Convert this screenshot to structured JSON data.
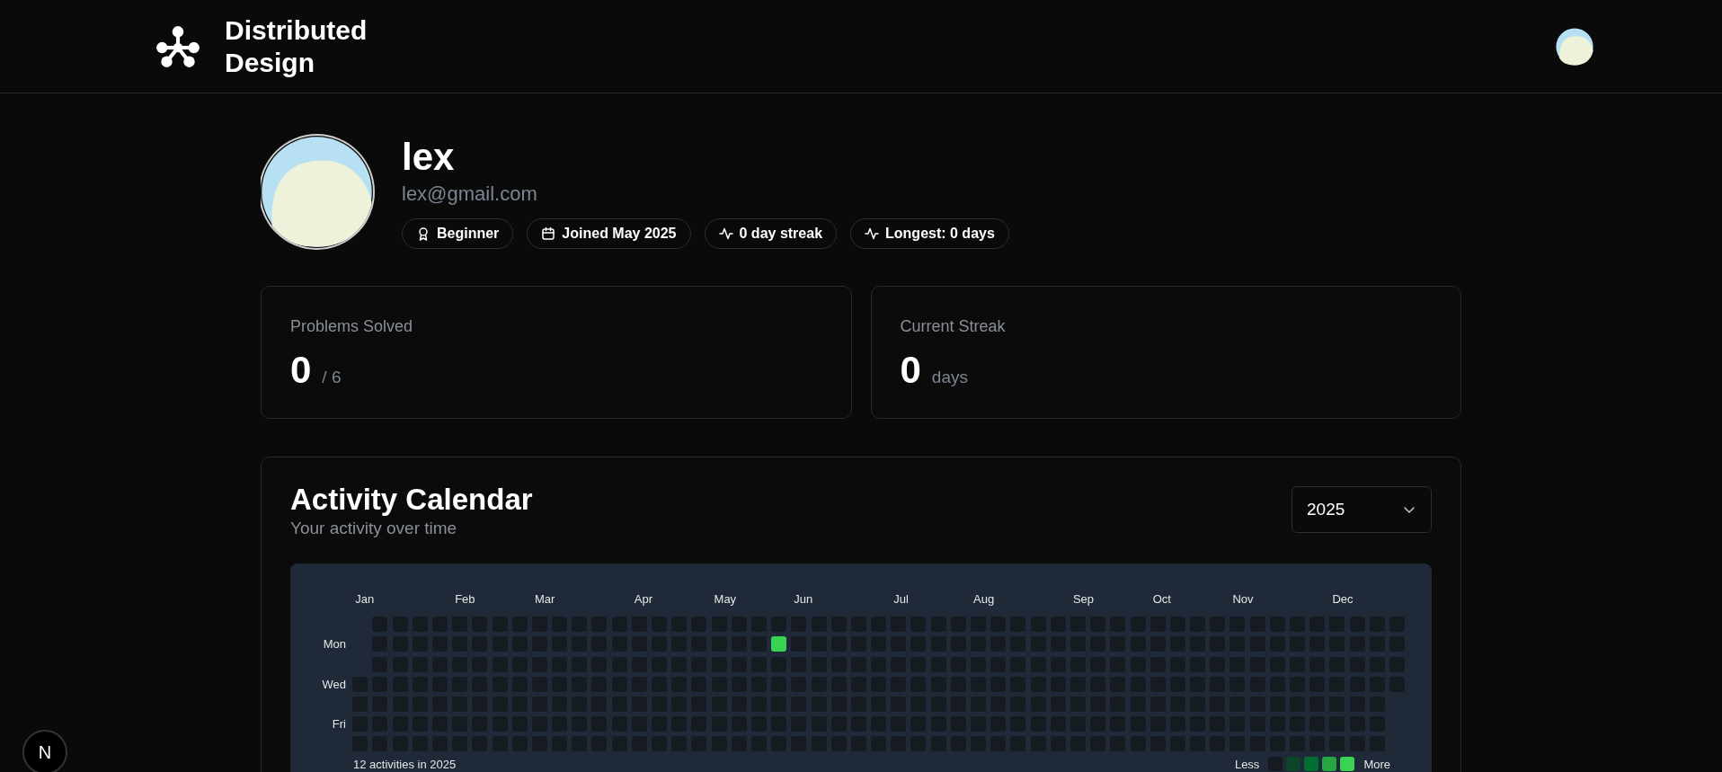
{
  "header": {
    "brand": "Distributed Design"
  },
  "profile": {
    "name": "lex",
    "email": "lex@gmail.com",
    "badges": [
      {
        "kind": "award",
        "label": "Beginner"
      },
      {
        "kind": "calendar",
        "label": "Joined May 2025"
      },
      {
        "kind": "activity",
        "label": "0 day streak"
      },
      {
        "kind": "activity",
        "label": "Longest: 0 days"
      }
    ]
  },
  "stats": [
    {
      "label": "Problems Solved",
      "value": "0",
      "suffix": "/ 6"
    },
    {
      "label": "Current Streak",
      "value": "0",
      "suffix": "days"
    }
  ],
  "activity_calendar": {
    "title": "Activity Calendar",
    "subtitle": "Your activity over time",
    "year_select": {
      "value": "2025"
    },
    "months": [
      "Jan",
      "Feb",
      "Mar",
      "Apr",
      "May",
      "Jun",
      "Jul",
      "Aug",
      "Sep",
      "Oct",
      "Nov",
      "Dec"
    ],
    "day_labels": [
      "Mon",
      "Wed",
      "Fri"
    ],
    "weeks": [
      {
        "days": [
          {
            "color": "#161b22"
          },
          {
            "color": "#161b22"
          },
          {
            "color": "#161b22"
          },
          {
            "color": "#161b22"
          }
        ]
      },
      {
        "days": [
          {
            "color": "#161b22"
          },
          {
            "color": "#161b22"
          },
          {
            "color": "#161b22"
          },
          {
            "color": "#161b22"
          },
          {
            "color": "#161b22"
          },
          {
            "color": "#161b22"
          },
          {
            "color": "#161b22"
          }
        ]
      },
      {
        "days": [
          {
            "color": "#161b22"
          },
          {
            "color": "#161b22"
          },
          {
            "color": "#161b22"
          },
          {
            "color": "#161b22"
          },
          {
            "color": "#161b22"
          },
          {
            "color": "#161b22"
          },
          {
            "color": "#161b22"
          }
        ]
      },
      {
        "days": [
          {
            "color": "#161b22"
          },
          {
            "color": "#161b22"
          },
          {
            "color": "#161b22"
          },
          {
            "color": "#161b22"
          },
          {
            "color": "#161b22"
          },
          {
            "color": "#161b22"
          },
          {
            "color": "#161b22"
          }
        ]
      },
      {
        "days": [
          {
            "color": "#161b22"
          },
          {
            "color": "#161b22"
          },
          {
            "color": "#161b22"
          },
          {
            "color": "#161b22"
          },
          {
            "color": "#161b22"
          },
          {
            "color": "#161b22"
          },
          {
            "color": "#161b22"
          }
        ]
      },
      {
        "days": [
          {
            "color": "#161b22"
          },
          {
            "color": "#161b22"
          },
          {
            "color": "#161b22"
          },
          {
            "color": "#161b22"
          },
          {
            "color": "#161b22"
          },
          {
            "color": "#161b22"
          },
          {
            "color": "#161b22"
          }
        ]
      },
      {
        "days": [
          {
            "color": "#161b22"
          },
          {
            "color": "#161b22"
          },
          {
            "color": "#161b22"
          },
          {
            "color": "#161b22"
          },
          {
            "color": "#161b22"
          },
          {
            "color": "#161b22"
          },
          {
            "color": "#161b22"
          }
        ]
      },
      {
        "days": [
          {
            "color": "#161b22"
          },
          {
            "color": "#161b22"
          },
          {
            "color": "#161b22"
          },
          {
            "color": "#161b22"
          },
          {
            "color": "#161b22"
          },
          {
            "color": "#161b22"
          },
          {
            "color": "#161b22"
          }
        ]
      },
      {
        "days": [
          {
            "color": "#161b22"
          },
          {
            "color": "#161b22"
          },
          {
            "color": "#161b22"
          },
          {
            "color": "#161b22"
          },
          {
            "color": "#161b22"
          },
          {
            "color": "#161b22"
          },
          {
            "color": "#161b22"
          }
        ]
      },
      {
        "days": [
          {
            "color": "#161b22"
          },
          {
            "color": "#161b22"
          },
          {
            "color": "#161b22"
          },
          {
            "color": "#161b22"
          },
          {
            "color": "#161b22"
          },
          {
            "color": "#161b22"
          },
          {
            "color": "#161b22"
          }
        ]
      },
      {
        "days": [
          {
            "color": "#161b22"
          },
          {
            "color": "#161b22"
          },
          {
            "color": "#161b22"
          },
          {
            "color": "#161b22"
          },
          {
            "color": "#161b22"
          },
          {
            "color": "#161b22"
          },
          {
            "color": "#161b22"
          }
        ]
      },
      {
        "days": [
          {
            "color": "#161b22"
          },
          {
            "color": "#161b22"
          },
          {
            "color": "#161b22"
          },
          {
            "color": "#161b22"
          },
          {
            "color": "#161b22"
          },
          {
            "color": "#161b22"
          },
          {
            "color": "#161b22"
          }
        ]
      },
      {
        "days": [
          {
            "color": "#161b22"
          },
          {
            "color": "#161b22"
          },
          {
            "color": "#161b22"
          },
          {
            "color": "#161b22"
          },
          {
            "color": "#161b22"
          },
          {
            "color": "#161b22"
          },
          {
            "color": "#161b22"
          }
        ]
      },
      {
        "days": [
          {
            "color": "#161b22"
          },
          {
            "color": "#161b22"
          },
          {
            "color": "#161b22"
          },
          {
            "color": "#161b22"
          },
          {
            "color": "#161b22"
          },
          {
            "color": "#161b22"
          },
          {
            "color": "#161b22"
          }
        ]
      },
      {
        "days": [
          {
            "color": "#161b22"
          },
          {
            "color": "#161b22"
          },
          {
            "color": "#161b22"
          },
          {
            "color": "#161b22"
          },
          {
            "color": "#161b22"
          },
          {
            "color": "#161b22"
          },
          {
            "color": "#161b22"
          }
        ]
      },
      {
        "days": [
          {
            "color": "#161b22"
          },
          {
            "color": "#161b22"
          },
          {
            "color": "#161b22"
          },
          {
            "color": "#161b22"
          },
          {
            "color": "#161b22"
          },
          {
            "color": "#161b22"
          },
          {
            "color": "#161b22"
          }
        ]
      },
      {
        "days": [
          {
            "color": "#161b22"
          },
          {
            "color": "#161b22"
          },
          {
            "color": "#161b22"
          },
          {
            "color": "#161b22"
          },
          {
            "color": "#161b22"
          },
          {
            "color": "#161b22"
          },
          {
            "color": "#161b22"
          }
        ]
      },
      {
        "days": [
          {
            "color": "#161b22"
          },
          {
            "color": "#161b22"
          },
          {
            "color": "#161b22"
          },
          {
            "color": "#161b22"
          },
          {
            "color": "#161b22"
          },
          {
            "color": "#161b22"
          },
          {
            "color": "#161b22"
          }
        ]
      },
      {
        "days": [
          {
            "color": "#161b22"
          },
          {
            "color": "#161b22"
          },
          {
            "color": "#161b22"
          },
          {
            "color": "#161b22"
          },
          {
            "color": "#161b22"
          },
          {
            "color": "#161b22"
          },
          {
            "color": "#161b22"
          }
        ]
      },
      {
        "days": [
          {
            "color": "#161b22"
          },
          {
            "color": "#161b22"
          },
          {
            "color": "#161b22"
          },
          {
            "color": "#161b22"
          },
          {
            "color": "#161b22"
          },
          {
            "color": "#161b22"
          },
          {
            "color": "#161b22"
          }
        ]
      },
      {
        "days": [
          {
            "color": "#161b22"
          },
          {
            "color": "#161b22"
          },
          {
            "color": "#161b22"
          },
          {
            "color": "#161b22"
          },
          {
            "color": "#161b22"
          },
          {
            "color": "#161b22"
          },
          {
            "color": "#161b22"
          }
        ]
      },
      {
        "days": [
          {
            "color": "#161b22"
          },
          {
            "color": "#39d353"
          },
          {
            "color": "#161b22"
          },
          {
            "color": "#161b22"
          },
          {
            "color": "#161b22"
          },
          {
            "color": "#161b22"
          },
          {
            "color": "#161b22"
          }
        ]
      },
      {
        "days": [
          {
            "color": "#161b22"
          },
          {
            "color": "#161b22"
          },
          {
            "color": "#161b22"
          },
          {
            "color": "#161b22"
          },
          {
            "color": "#161b22"
          },
          {
            "color": "#161b22"
          },
          {
            "color": "#161b22"
          }
        ]
      },
      {
        "days": [
          {
            "color": "#161b22"
          },
          {
            "color": "#161b22"
          },
          {
            "color": "#161b22"
          },
          {
            "color": "#161b22"
          },
          {
            "color": "#161b22"
          },
          {
            "color": "#161b22"
          },
          {
            "color": "#161b22"
          }
        ]
      },
      {
        "days": [
          {
            "color": "#161b22"
          },
          {
            "color": "#161b22"
          },
          {
            "color": "#161b22"
          },
          {
            "color": "#161b22"
          },
          {
            "color": "#161b22"
          },
          {
            "color": "#161b22"
          },
          {
            "color": "#161b22"
          }
        ]
      },
      {
        "days": [
          {
            "color": "#161b22"
          },
          {
            "color": "#161b22"
          },
          {
            "color": "#161b22"
          },
          {
            "color": "#161b22"
          },
          {
            "color": "#161b22"
          },
          {
            "color": "#161b22"
          },
          {
            "color": "#161b22"
          }
        ]
      },
      {
        "days": [
          {
            "color": "#161b22"
          },
          {
            "color": "#161b22"
          },
          {
            "color": "#161b22"
          },
          {
            "color": "#161b22"
          },
          {
            "color": "#161b22"
          },
          {
            "color": "#161b22"
          },
          {
            "color": "#161b22"
          }
        ]
      },
      {
        "days": [
          {
            "color": "#161b22"
          },
          {
            "color": "#161b22"
          },
          {
            "color": "#161b22"
          },
          {
            "color": "#161b22"
          },
          {
            "color": "#161b22"
          },
          {
            "color": "#161b22"
          },
          {
            "color": "#161b22"
          }
        ]
      },
      {
        "days": [
          {
            "color": "#161b22"
          },
          {
            "color": "#161b22"
          },
          {
            "color": "#161b22"
          },
          {
            "color": "#161b22"
          },
          {
            "color": "#161b22"
          },
          {
            "color": "#161b22"
          },
          {
            "color": "#161b22"
          }
        ]
      },
      {
        "days": [
          {
            "color": "#161b22"
          },
          {
            "color": "#161b22"
          },
          {
            "color": "#161b22"
          },
          {
            "color": "#161b22"
          },
          {
            "color": "#161b22"
          },
          {
            "color": "#161b22"
          },
          {
            "color": "#161b22"
          }
        ]
      },
      {
        "days": [
          {
            "color": "#161b22"
          },
          {
            "color": "#161b22"
          },
          {
            "color": "#161b22"
          },
          {
            "color": "#161b22"
          },
          {
            "color": "#161b22"
          },
          {
            "color": "#161b22"
          },
          {
            "color": "#161b22"
          }
        ]
      },
      {
        "days": [
          {
            "color": "#161b22"
          },
          {
            "color": "#161b22"
          },
          {
            "color": "#161b22"
          },
          {
            "color": "#161b22"
          },
          {
            "color": "#161b22"
          },
          {
            "color": "#161b22"
          },
          {
            "color": "#161b22"
          }
        ]
      },
      {
        "days": [
          {
            "color": "#161b22"
          },
          {
            "color": "#161b22"
          },
          {
            "color": "#161b22"
          },
          {
            "color": "#161b22"
          },
          {
            "color": "#161b22"
          },
          {
            "color": "#161b22"
          },
          {
            "color": "#161b22"
          }
        ]
      },
      {
        "days": [
          {
            "color": "#161b22"
          },
          {
            "color": "#161b22"
          },
          {
            "color": "#161b22"
          },
          {
            "color": "#161b22"
          },
          {
            "color": "#161b22"
          },
          {
            "color": "#161b22"
          },
          {
            "color": "#161b22"
          }
        ]
      },
      {
        "days": [
          {
            "color": "#161b22"
          },
          {
            "color": "#161b22"
          },
          {
            "color": "#161b22"
          },
          {
            "color": "#161b22"
          },
          {
            "color": "#161b22"
          },
          {
            "color": "#161b22"
          },
          {
            "color": "#161b22"
          }
        ]
      },
      {
        "days": [
          {
            "color": "#161b22"
          },
          {
            "color": "#161b22"
          },
          {
            "color": "#161b22"
          },
          {
            "color": "#161b22"
          },
          {
            "color": "#161b22"
          },
          {
            "color": "#161b22"
          },
          {
            "color": "#161b22"
          }
        ]
      },
      {
        "days": [
          {
            "color": "#161b22"
          },
          {
            "color": "#161b22"
          },
          {
            "color": "#161b22"
          },
          {
            "color": "#161b22"
          },
          {
            "color": "#161b22"
          },
          {
            "color": "#161b22"
          },
          {
            "color": "#161b22"
          }
        ]
      },
      {
        "days": [
          {
            "color": "#161b22"
          },
          {
            "color": "#161b22"
          },
          {
            "color": "#161b22"
          },
          {
            "color": "#161b22"
          },
          {
            "color": "#161b22"
          },
          {
            "color": "#161b22"
          },
          {
            "color": "#161b22"
          }
        ]
      },
      {
        "days": [
          {
            "color": "#161b22"
          },
          {
            "color": "#161b22"
          },
          {
            "color": "#161b22"
          },
          {
            "color": "#161b22"
          },
          {
            "color": "#161b22"
          },
          {
            "color": "#161b22"
          },
          {
            "color": "#161b22"
          }
        ]
      },
      {
        "days": [
          {
            "color": "#161b22"
          },
          {
            "color": "#161b22"
          },
          {
            "color": "#161b22"
          },
          {
            "color": "#161b22"
          },
          {
            "color": "#161b22"
          },
          {
            "color": "#161b22"
          },
          {
            "color": "#161b22"
          }
        ]
      },
      {
        "days": [
          {
            "color": "#161b22"
          },
          {
            "color": "#161b22"
          },
          {
            "color": "#161b22"
          },
          {
            "color": "#161b22"
          },
          {
            "color": "#161b22"
          },
          {
            "color": "#161b22"
          },
          {
            "color": "#161b22"
          }
        ]
      },
      {
        "days": [
          {
            "color": "#161b22"
          },
          {
            "color": "#161b22"
          },
          {
            "color": "#161b22"
          },
          {
            "color": "#161b22"
          },
          {
            "color": "#161b22"
          },
          {
            "color": "#161b22"
          },
          {
            "color": "#161b22"
          }
        ]
      },
      {
        "days": [
          {
            "color": "#161b22"
          },
          {
            "color": "#161b22"
          },
          {
            "color": "#161b22"
          },
          {
            "color": "#161b22"
          },
          {
            "color": "#161b22"
          },
          {
            "color": "#161b22"
          },
          {
            "color": "#161b22"
          }
        ]
      },
      {
        "days": [
          {
            "color": "#161b22"
          },
          {
            "color": "#161b22"
          },
          {
            "color": "#161b22"
          },
          {
            "color": "#161b22"
          },
          {
            "color": "#161b22"
          },
          {
            "color": "#161b22"
          },
          {
            "color": "#161b22"
          }
        ]
      },
      {
        "days": [
          {
            "color": "#161b22"
          },
          {
            "color": "#161b22"
          },
          {
            "color": "#161b22"
          },
          {
            "color": "#161b22"
          },
          {
            "color": "#161b22"
          },
          {
            "color": "#161b22"
          },
          {
            "color": "#161b22"
          }
        ]
      },
      {
        "days": [
          {
            "color": "#161b22"
          },
          {
            "color": "#161b22"
          },
          {
            "color": "#161b22"
          },
          {
            "color": "#161b22"
          },
          {
            "color": "#161b22"
          },
          {
            "color": "#161b22"
          },
          {
            "color": "#161b22"
          }
        ]
      },
      {
        "days": [
          {
            "color": "#161b22"
          },
          {
            "color": "#161b22"
          },
          {
            "color": "#161b22"
          },
          {
            "color": "#161b22"
          },
          {
            "color": "#161b22"
          },
          {
            "color": "#161b22"
          },
          {
            "color": "#161b22"
          }
        ]
      },
      {
        "days": [
          {
            "color": "#161b22"
          },
          {
            "color": "#161b22"
          },
          {
            "color": "#161b22"
          },
          {
            "color": "#161b22"
          },
          {
            "color": "#161b22"
          },
          {
            "color": "#161b22"
          },
          {
            "color": "#161b22"
          }
        ]
      },
      {
        "days": [
          {
            "color": "#161b22"
          },
          {
            "color": "#161b22"
          },
          {
            "color": "#161b22"
          },
          {
            "color": "#161b22"
          },
          {
            "color": "#161b22"
          },
          {
            "color": "#161b22"
          },
          {
            "color": "#161b22"
          }
        ]
      },
      {
        "days": [
          {
            "color": "#161b22"
          },
          {
            "color": "#161b22"
          },
          {
            "color": "#161b22"
          },
          {
            "color": "#161b22"
          },
          {
            "color": "#161b22"
          },
          {
            "color": "#161b22"
          },
          {
            "color": "#161b22"
          }
        ]
      },
      {
        "days": [
          {
            "color": "#161b22"
          },
          {
            "color": "#161b22"
          },
          {
            "color": "#161b22"
          },
          {
            "color": "#161b22"
          },
          {
            "color": "#161b22"
          },
          {
            "color": "#161b22"
          },
          {
            "color": "#161b22"
          }
        ]
      },
      {
        "days": [
          {
            "color": "#161b22"
          },
          {
            "color": "#161b22"
          },
          {
            "color": "#161b22"
          },
          {
            "color": "#161b22"
          },
          {
            "color": "#161b22"
          },
          {
            "color": "#161b22"
          },
          {
            "color": "#161b22"
          }
        ]
      },
      {
        "days": [
          {
            "color": "#161b22"
          },
          {
            "color": "#161b22"
          },
          {
            "color": "#161b22"
          },
          {
            "color": "#161b22"
          }
        ]
      }
    ],
    "summary": "12 activities in 2025",
    "legend": {
      "less": "Less",
      "more": "More",
      "swatches": [
        {
          "color": "#161b22"
        },
        {
          "color": "#0e4429"
        },
        {
          "color": "#006d32"
        },
        {
          "color": "#26a641"
        },
        {
          "color": "#39d353"
        }
      ]
    }
  },
  "dev_badge": {
    "label": "N"
  }
}
